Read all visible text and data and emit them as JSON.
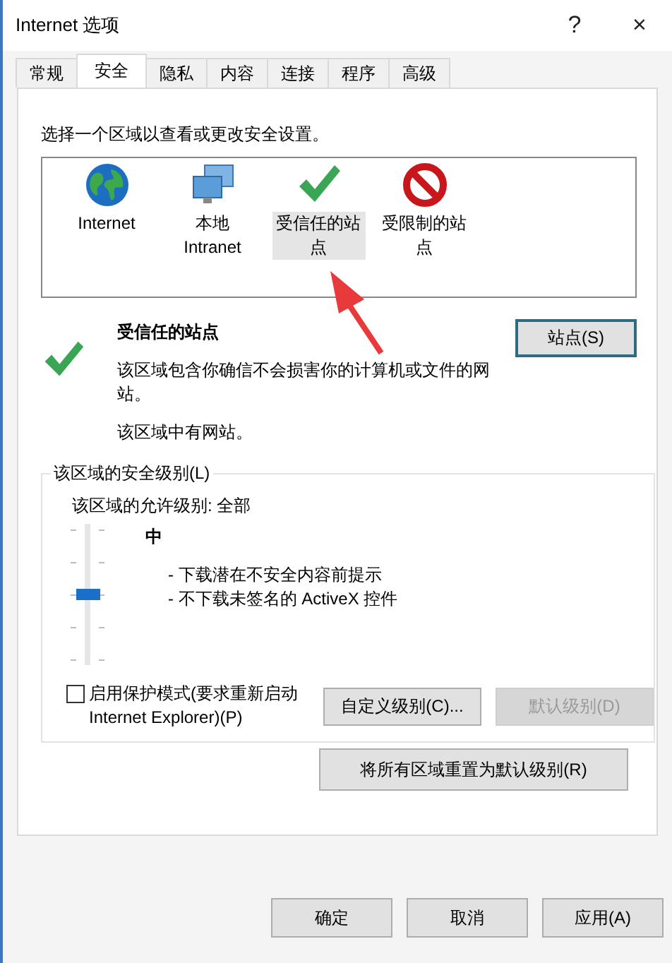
{
  "window": {
    "title": "Internet 选项",
    "help": "?",
    "close": "×"
  },
  "tabs": [
    {
      "label": "常规",
      "selected": false
    },
    {
      "label": "安全",
      "selected": true
    },
    {
      "label": "隐私",
      "selected": false
    },
    {
      "label": "内容",
      "selected": false
    },
    {
      "label": "连接",
      "selected": false
    },
    {
      "label": "程序",
      "selected": false
    },
    {
      "label": "高级",
      "selected": false
    }
  ],
  "zone_prompt": "选择一个区域以查看或更改安全设置。",
  "zones": [
    {
      "kind": "globe",
      "label": "Internet",
      "selected": false
    },
    {
      "kind": "network",
      "label": "本地 Intranet",
      "selected": false
    },
    {
      "kind": "trusted",
      "label": "受信任的站点",
      "selected": true
    },
    {
      "kind": "restricted",
      "label": "受限制的站点",
      "selected": false
    }
  ],
  "zone_info": {
    "kind": "trusted",
    "title": "受信任的站点",
    "description": "该区域包含你确信不会损害你的计算机或文件的网站。",
    "note": "该区域中有网站。",
    "sites_button": "站点(S)"
  },
  "security_level": {
    "legend": "该区域的安全级别(L)",
    "allowed": "该区域的允许级别: 全部",
    "level": 0.5,
    "level_name": "中",
    "details": [
      "- 下载潜在不安全内容前提示",
      "- 不下载未签名的 ActiveX 控件"
    ],
    "protected_mode": {
      "label": "启用保护模式(要求重新启动 Internet Explorer)(P)",
      "checked": false
    },
    "buttons": [
      {
        "label": "自定义级别(C)...",
        "disabled": false
      },
      {
        "label": "默认级别(D)",
        "disabled": true
      }
    ]
  },
  "reset_button": "将所有区域重置为默认级别(R)",
  "dialog_buttons": [
    {
      "label": "确定",
      "disabled": false
    },
    {
      "label": "取消",
      "disabled": false
    },
    {
      "label": "应用(A)",
      "disabled": false
    }
  ]
}
